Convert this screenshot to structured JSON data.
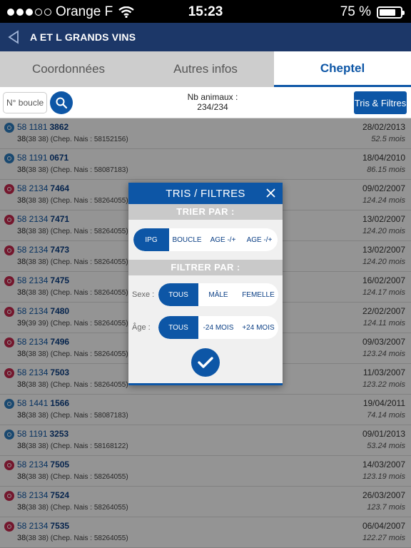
{
  "status_bar": {
    "carrier": "Orange F",
    "time": "15:23",
    "battery": "75 %"
  },
  "nav": {
    "title": "A ET L GRANDS VINS"
  },
  "tabs": [
    {
      "label": "Coordonnées"
    },
    {
      "label": "Autres infos"
    },
    {
      "label": "Cheptel"
    }
  ],
  "search": {
    "placeholder": "N° boucle",
    "count_label": "Nb animaux :",
    "count_value": "234/234",
    "filter_button": "Tris & Filtres"
  },
  "rows": [
    {
      "sex": "m",
      "prefix": "58 1181",
      "num": "3862",
      "code": "38",
      "paren": "(38 38)",
      "mother": "(Chep. Nais : 58152156)",
      "date": "28/02/2013",
      "age": "52.5 mois"
    },
    {
      "sex": "m",
      "prefix": "58 1191",
      "num": "0671",
      "code": "38",
      "paren": "(38 38)",
      "mother": "(Chep. Nais : 58087183)",
      "date": "18/04/2010",
      "age": "86.15 mois"
    },
    {
      "sex": "f",
      "prefix": "58 2134",
      "num": "7464",
      "code": "38",
      "paren": "(38 38)",
      "mother": "(Chep. Nais : 58264055)",
      "date": "09/02/2007",
      "age": "124.24 mois"
    },
    {
      "sex": "f",
      "prefix": "58 2134",
      "num": "7471",
      "code": "38",
      "paren": "(38 38)",
      "mother": "(Chep. Nais : 58264055)",
      "date": "13/02/2007",
      "age": "124.20 mois"
    },
    {
      "sex": "f",
      "prefix": "58 2134",
      "num": "7473",
      "code": "38",
      "paren": "(38 38)",
      "mother": "(Chep. Nais : 58264055)",
      "date": "13/02/2007",
      "age": "124.20 mois"
    },
    {
      "sex": "f",
      "prefix": "58 2134",
      "num": "7475",
      "code": "38",
      "paren": "(38 38)",
      "mother": "(Chep. Nais : 58264055)",
      "date": "16/02/2007",
      "age": "124.17 mois"
    },
    {
      "sex": "f",
      "prefix": "58 2134",
      "num": "7480",
      "code": "39",
      "paren": "(39 39)",
      "mother": "(Chep. Nais : 58264055)",
      "date": "22/02/2007",
      "age": "124.11 mois"
    },
    {
      "sex": "f",
      "prefix": "58 2134",
      "num": "7496",
      "code": "38",
      "paren": "(38 38)",
      "mother": "(Chep. Nais : 58264055)",
      "date": "09/03/2007",
      "age": "123.24 mois"
    },
    {
      "sex": "f",
      "prefix": "58 2134",
      "num": "7503",
      "code": "38",
      "paren": "(38 38)",
      "mother": "(Chep. Nais : 58264055)",
      "date": "11/03/2007",
      "age": "123.22 mois"
    },
    {
      "sex": "m",
      "prefix": "58 1441",
      "num": "1566",
      "code": "38",
      "paren": "(38 38)",
      "mother": "(Chep. Nais : 58087183)",
      "date": "19/04/2011",
      "age": "74.14 mois"
    },
    {
      "sex": "m",
      "prefix": "58 1191",
      "num": "3253",
      "code": "38",
      "paren": "(38 38)",
      "mother": "(Chep. Nais : 58168122)",
      "date": "09/01/2013",
      "age": "53.24 mois"
    },
    {
      "sex": "f",
      "prefix": "58 2134",
      "num": "7505",
      "code": "38",
      "paren": "(38 38)",
      "mother": "(Chep. Nais : 58264055)",
      "date": "14/03/2007",
      "age": "123.19 mois"
    },
    {
      "sex": "f",
      "prefix": "58 2134",
      "num": "7524",
      "code": "38",
      "paren": "(38 38)",
      "mother": "(Chep. Nais : 58264055)",
      "date": "26/03/2007",
      "age": "123.7 mois"
    },
    {
      "sex": "f",
      "prefix": "58 2134",
      "num": "7535",
      "code": "38",
      "paren": "(38 38)",
      "mother": "(Chep. Nais : 58264055)",
      "date": "06/04/2007",
      "age": "122.27 mois"
    }
  ],
  "modal": {
    "title": "TRIS / FILTRES",
    "sort_header": "TRIER PAR :",
    "sort_options": [
      "IPG",
      "BOUCLE",
      "AGE -/+",
      "AGE -/+"
    ],
    "filter_header": "FILTRER PAR :",
    "sex_label": "Sexe :",
    "sex_options": [
      "TOUS",
      "MÂLE",
      "FEMELLE"
    ],
    "age_label": "Âge :",
    "age_options": [
      "TOUS",
      "-24 MOIS",
      "+24 MOIS"
    ]
  },
  "colors": {
    "primary": "#0d56a6",
    "nav_bg": "#1c3768",
    "male": "#2d7fc2",
    "female": "#c8284f"
  }
}
